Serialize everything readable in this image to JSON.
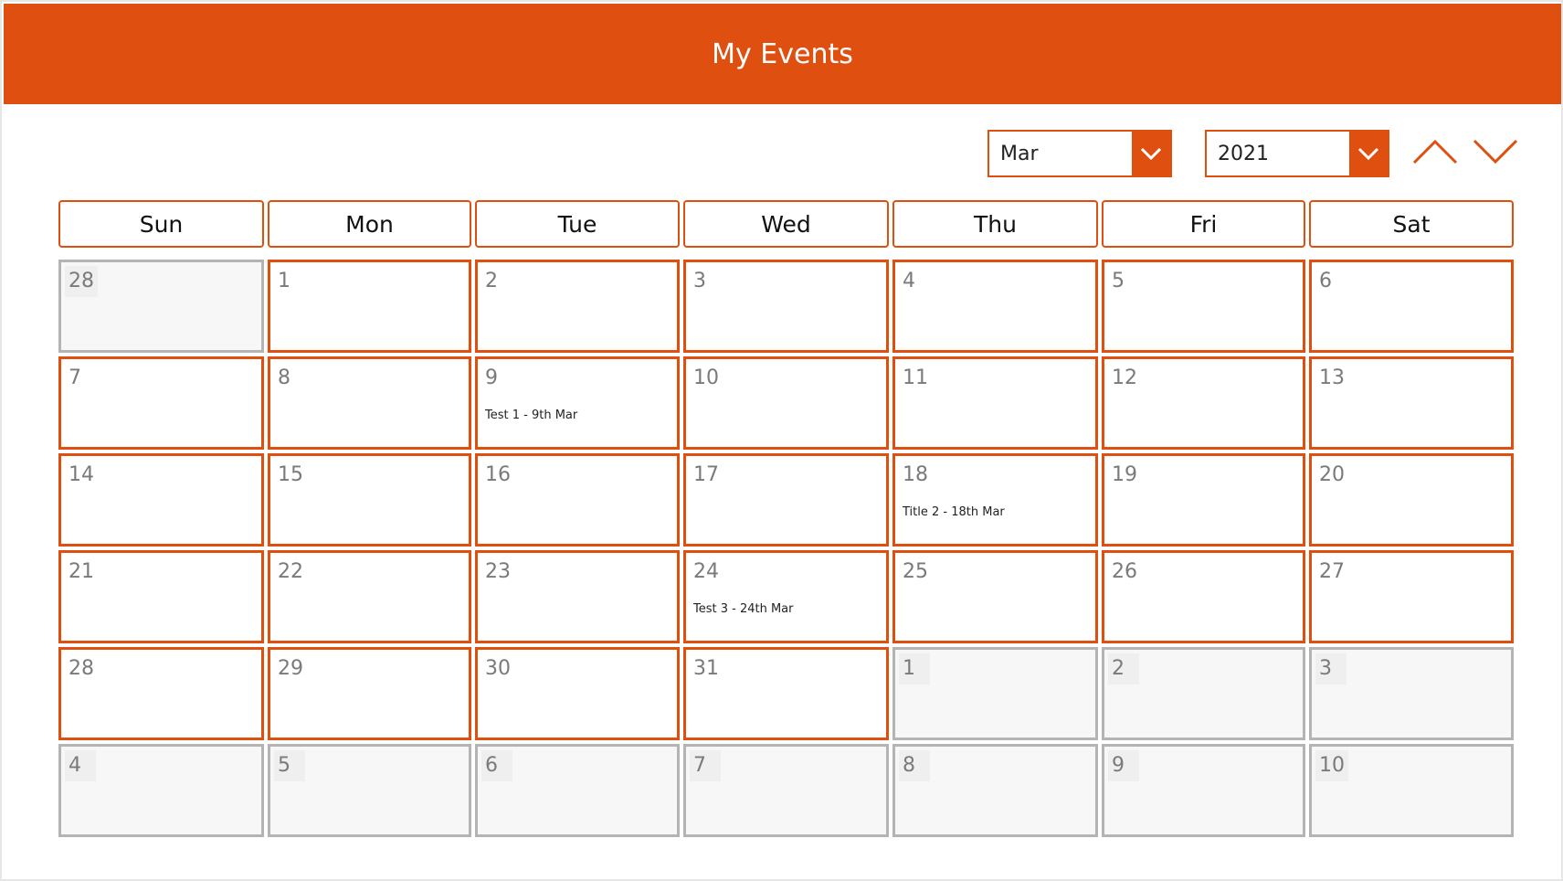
{
  "header": {
    "title": "My Events"
  },
  "controls": {
    "month_value": "Mar",
    "year_value": "2021"
  },
  "weekdays": [
    "Sun",
    "Mon",
    "Tue",
    "Wed",
    "Thu",
    "Fri",
    "Sat"
  ],
  "weeks": [
    [
      {
        "day": "28",
        "other": true,
        "event": ""
      },
      {
        "day": "1",
        "other": false,
        "event": ""
      },
      {
        "day": "2",
        "other": false,
        "event": ""
      },
      {
        "day": "3",
        "other": false,
        "event": ""
      },
      {
        "day": "4",
        "other": false,
        "event": ""
      },
      {
        "day": "5",
        "other": false,
        "event": ""
      },
      {
        "day": "6",
        "other": false,
        "event": ""
      }
    ],
    [
      {
        "day": "7",
        "other": false,
        "event": ""
      },
      {
        "day": "8",
        "other": false,
        "event": ""
      },
      {
        "day": "9",
        "other": false,
        "event": "Test 1 - 9th Mar"
      },
      {
        "day": "10",
        "other": false,
        "event": ""
      },
      {
        "day": "11",
        "other": false,
        "event": ""
      },
      {
        "day": "12",
        "other": false,
        "event": ""
      },
      {
        "day": "13",
        "other": false,
        "event": ""
      }
    ],
    [
      {
        "day": "14",
        "other": false,
        "event": ""
      },
      {
        "day": "15",
        "other": false,
        "event": ""
      },
      {
        "day": "16",
        "other": false,
        "event": ""
      },
      {
        "day": "17",
        "other": false,
        "event": ""
      },
      {
        "day": "18",
        "other": false,
        "event": "Title 2 - 18th Mar"
      },
      {
        "day": "19",
        "other": false,
        "event": ""
      },
      {
        "day": "20",
        "other": false,
        "event": ""
      }
    ],
    [
      {
        "day": "21",
        "other": false,
        "event": ""
      },
      {
        "day": "22",
        "other": false,
        "event": ""
      },
      {
        "day": "23",
        "other": false,
        "event": ""
      },
      {
        "day": "24",
        "other": false,
        "event": "Test 3 - 24th Mar"
      },
      {
        "day": "25",
        "other": false,
        "event": ""
      },
      {
        "day": "26",
        "other": false,
        "event": ""
      },
      {
        "day": "27",
        "other": false,
        "event": ""
      }
    ],
    [
      {
        "day": "28",
        "other": false,
        "event": ""
      },
      {
        "day": "29",
        "other": false,
        "event": ""
      },
      {
        "day": "30",
        "other": false,
        "event": ""
      },
      {
        "day": "31",
        "other": false,
        "event": ""
      },
      {
        "day": "1",
        "other": true,
        "event": ""
      },
      {
        "day": "2",
        "other": true,
        "event": ""
      },
      {
        "day": "3",
        "other": true,
        "event": ""
      }
    ],
    [
      {
        "day": "4",
        "other": true,
        "event": ""
      },
      {
        "day": "5",
        "other": true,
        "event": ""
      },
      {
        "day": "6",
        "other": true,
        "event": ""
      },
      {
        "day": "7",
        "other": true,
        "event": ""
      },
      {
        "day": "8",
        "other": true,
        "event": ""
      },
      {
        "day": "9",
        "other": true,
        "event": ""
      },
      {
        "day": "10",
        "other": true,
        "event": ""
      }
    ]
  ],
  "icons": {
    "month_dropdown": "chevron-down-icon",
    "year_dropdown": "chevron-down-icon",
    "previous": "chevron-up-icon",
    "next": "chevron-down-icon"
  },
  "colors": {
    "accent": "#df4f10",
    "other_month_border": "#b4b4b4",
    "other_month_fill": "#f7f7f7"
  }
}
